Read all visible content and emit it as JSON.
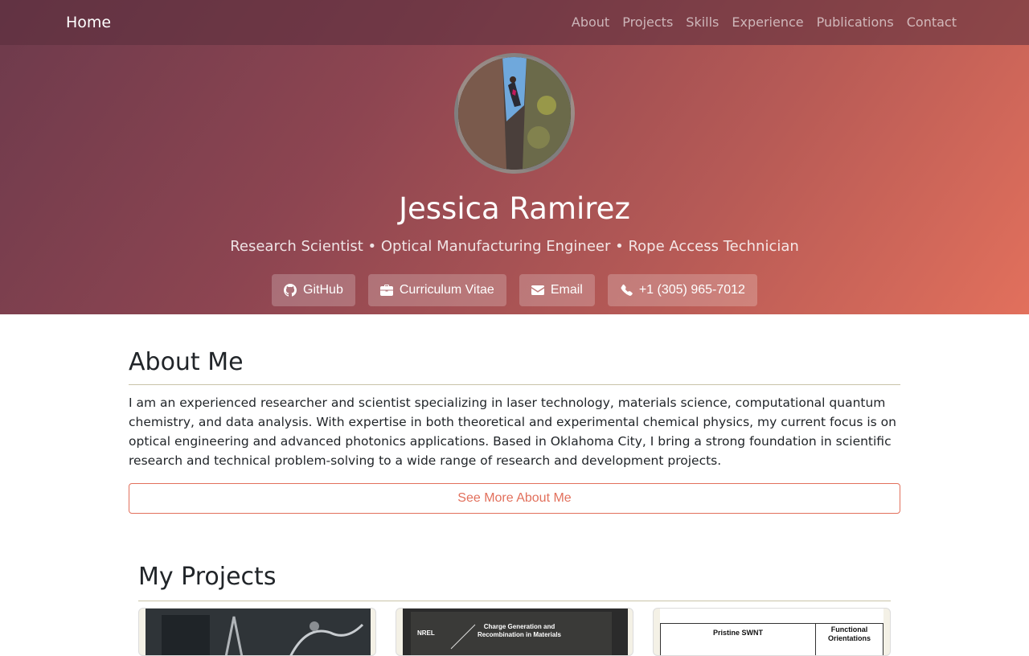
{
  "navbar": {
    "brand": "Home",
    "links": [
      "About",
      "Projects",
      "Skills",
      "Experience",
      "Publications",
      "Contact"
    ]
  },
  "hero": {
    "name": "Jessica Ramirez",
    "subtitle": "Research Scientist • Optical Manufacturing Engineer • Rope Access Technician",
    "buttons": [
      {
        "label": "GitHub",
        "icon": "github-icon"
      },
      {
        "label": "Curriculum Vitae",
        "icon": "briefcase-icon"
      },
      {
        "label": "Email",
        "icon": "envelope-icon"
      },
      {
        "label": "+1 (305) 965-7012",
        "icon": "phone-icon"
      }
    ]
  },
  "about": {
    "title": "About Me",
    "text": "I am an experienced researcher and scientist specializing in laser technology, materials science, computational quantum chemistry, and data analysis. With expertise in both theoretical and experimental chemical physics, my current focus is on optical engineering and advanced photonics applications. Based in Oklahoma City, I bring a strong foundation in scientific research and technical problem-solving to a wide range of research and development projects.",
    "more_label": "See More About Me"
  },
  "projects": {
    "title": "My Projects",
    "cards": [
      {
        "caption": ""
      },
      {
        "caption": "Charge Generation and Recombination in Materials",
        "brand": "NREL"
      },
      {
        "caption_left": "Pristine SWNT",
        "caption_right": "Functional Orientations"
      }
    ]
  },
  "colors": {
    "accent": "#e2705c",
    "hero_start": "#6d3a4c",
    "hero_end": "#e2705c"
  }
}
